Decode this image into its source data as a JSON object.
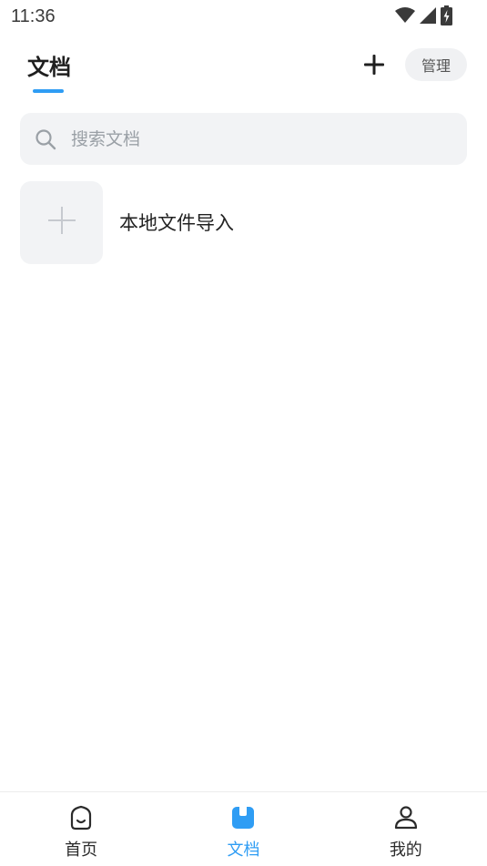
{
  "status_bar": {
    "time": "11:36",
    "icons": [
      "wifi-icon",
      "signal-icon",
      "battery-icon"
    ]
  },
  "header": {
    "title": "文档",
    "add_icon": "plus-icon",
    "manage_label": "管理"
  },
  "search": {
    "placeholder": "搜索文档",
    "value": "",
    "icon": "search-icon"
  },
  "import_item": {
    "label": "本地文件导入",
    "icon": "plus-icon"
  },
  "tabs": [
    {
      "label": "首页",
      "icon": "home-icon",
      "active": false
    },
    {
      "label": "文档",
      "icon": "document-icon",
      "active": true
    },
    {
      "label": "我的",
      "icon": "profile-icon",
      "active": false
    }
  ],
  "colors": {
    "accent": "#2f9df4",
    "background": "#ffffff",
    "surface": "#f2f3f5",
    "text": "#1f1f1f"
  }
}
